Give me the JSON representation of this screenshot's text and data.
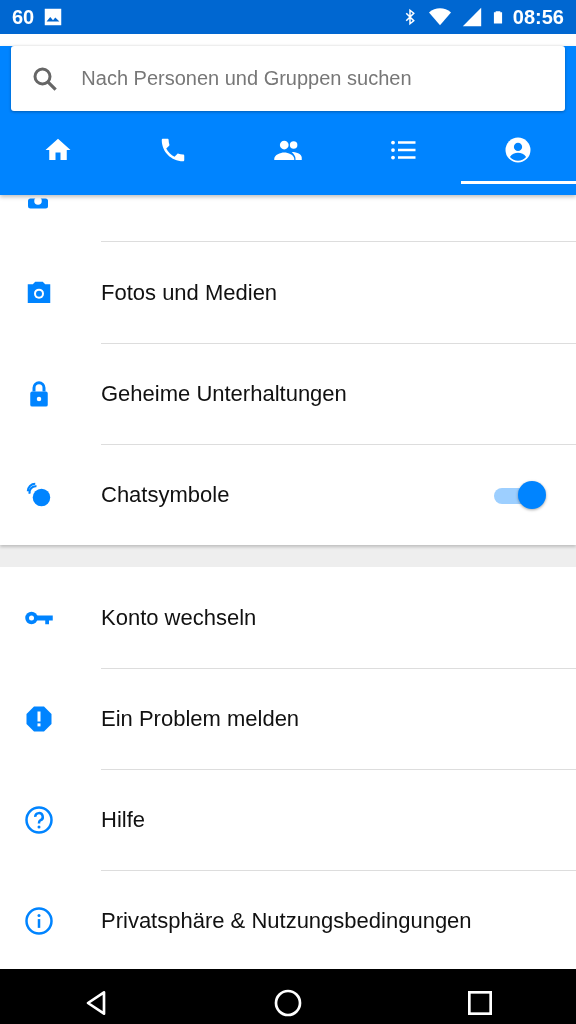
{
  "status_bar": {
    "left_text": "60",
    "time": "08:56"
  },
  "search": {
    "placeholder": "Nach Personen und Gruppen suchen"
  },
  "tabs": [
    {
      "selected": false
    },
    {
      "selected": false
    },
    {
      "selected": false
    },
    {
      "selected": false
    },
    {
      "selected": true
    }
  ],
  "sections": [
    {
      "items": [
        {
          "kind": "link",
          "label": "Fotos und Medien"
        },
        {
          "kind": "link",
          "label": "Geheime Unterhaltungen"
        },
        {
          "kind": "toggle",
          "label": "Chatsymbole",
          "on": true
        }
      ]
    },
    {
      "items": [
        {
          "kind": "link",
          "label": "Konto wechseln"
        },
        {
          "kind": "link",
          "label": "Ein Problem melden"
        },
        {
          "kind": "link",
          "label": "Hilfe"
        },
        {
          "kind": "link",
          "label": "Privatsphäre & Nutzungsbedingungen"
        }
      ]
    }
  ]
}
